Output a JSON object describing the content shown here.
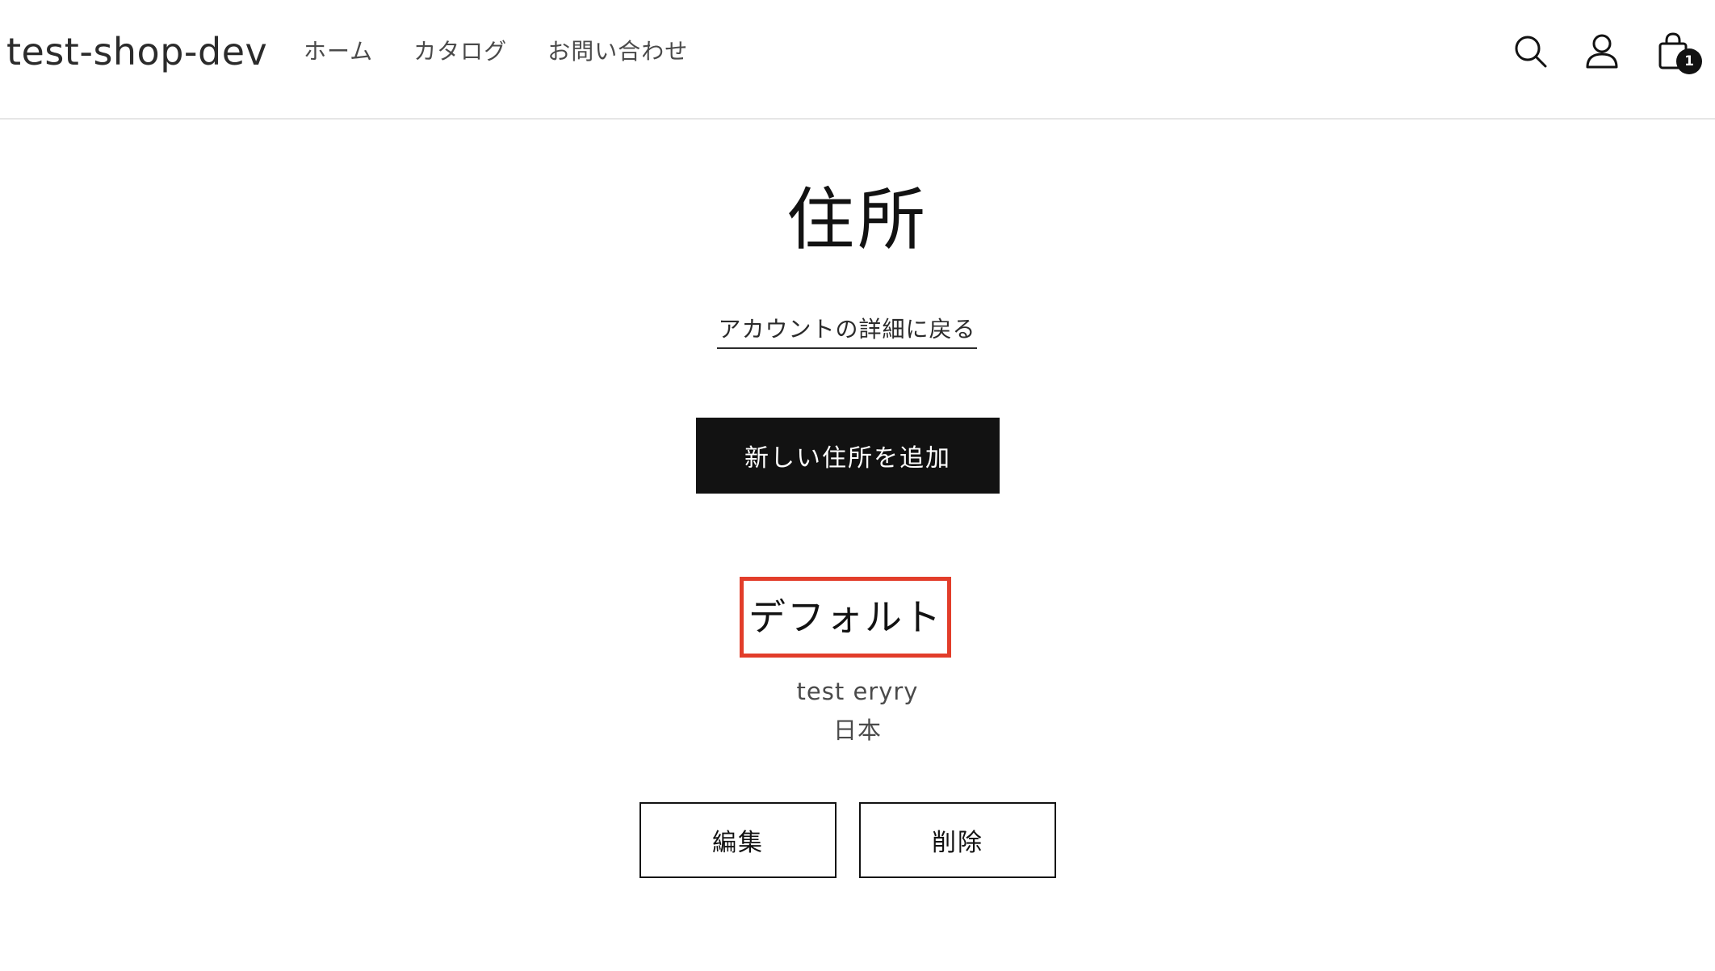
{
  "header": {
    "logo": "test-shop-dev",
    "nav": [
      {
        "label": "ホーム"
      },
      {
        "label": "カタログ"
      },
      {
        "label": "お問い合わせ"
      }
    ],
    "icons": {
      "search": "search-icon",
      "account": "account-icon",
      "cart": "cart-icon"
    },
    "cart_count": "1"
  },
  "main": {
    "title": "住所",
    "back_link": "アカウントの詳細に戻る",
    "add_button": "新しい住所を追加",
    "address": {
      "heading": "デフォルト",
      "name": "test eryry",
      "country": "日本",
      "edit_label": "編集",
      "delete_label": "削除"
    }
  },
  "colors": {
    "primary": "#121212",
    "highlight_border": "#e23d2a",
    "divider": "#e6e6e6"
  }
}
